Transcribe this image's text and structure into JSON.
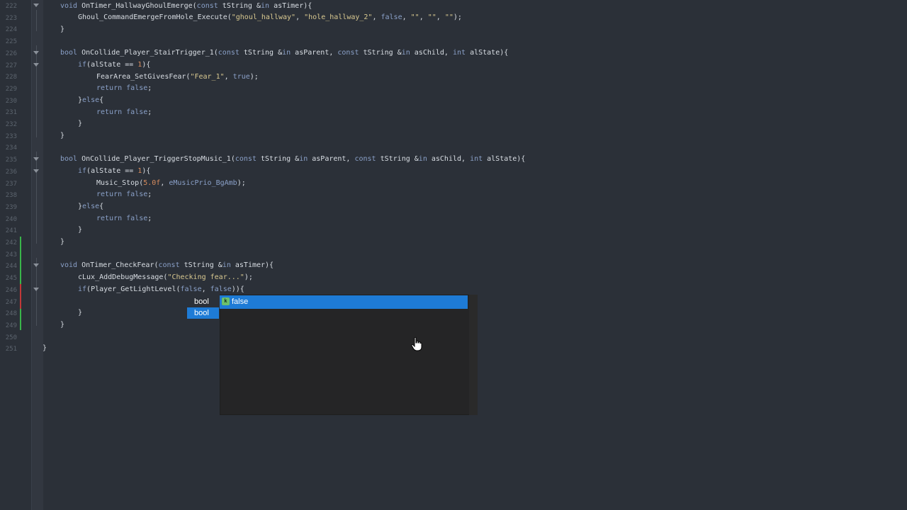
{
  "editor": {
    "line_numbers": [
      "222",
      "223",
      "224",
      "225",
      "226",
      "227",
      "228",
      "229",
      "230",
      "231",
      "232",
      "233",
      "234",
      "235",
      "236",
      "237",
      "238",
      "239",
      "240",
      "241",
      "242",
      "243",
      "244",
      "245",
      "246",
      "247",
      "248",
      "249",
      "250",
      "251"
    ],
    "lines": {
      "l222a": "void",
      "l222b": " OnTimer_HallwayGhoulEmerge(",
      "l222c": "const",
      "l222d": " tString &",
      "l222e": "in",
      "l222f": " asTimer){",
      "l223a": "Ghoul_CommandEmergeFromHole_Execute(",
      "l223b": "\"ghoul_hallway\"",
      "l223c": ", ",
      "l223d": "\"hole_hallway_2\"",
      "l223e": ", ",
      "l223f": "false",
      "l223g": ", ",
      "l223h": "\"\"",
      "l223i": ", ",
      "l223j": "\"\"",
      "l223k": ", ",
      "l223l": "\"\"",
      "l223m": ");",
      "l224": "}",
      "l226a": "bool",
      "l226b": " OnCollide_Player_StairTrigger_1(",
      "l226c": "const",
      "l226d": " tString &",
      "l226e": "in",
      "l226f": " asParent, ",
      "l226g": "const",
      "l226h": " tString &",
      "l226i": "in",
      "l226j": " asChild, ",
      "l226k": "int",
      "l226l": " alState){",
      "l227a": "if",
      "l227b": "(alState == ",
      "l227c": "1",
      "l227d": "){",
      "l228a": "FearArea_SetGivesFear(",
      "l228b": "\"Fear_1\"",
      "l228c": ", ",
      "l228d": "true",
      "l228e": ");",
      "l229a": "return",
      "l229b": " ",
      "l229c": "false",
      "l229d": ";",
      "l230a": "}",
      "l230b": "else",
      "l230c": "{",
      "l231a": "return",
      "l231b": " ",
      "l231c": "false",
      "l231d": ";",
      "l232": "}",
      "l233": "}",
      "l235a": "bool",
      "l235b": " OnCollide_Player_TriggerStopMusic_1(",
      "l235c": "const",
      "l235d": " tString &",
      "l235e": "in",
      "l235f": " asParent, ",
      "l235g": "const",
      "l235h": " tString &",
      "l235i": "in",
      "l235j": " asChild, ",
      "l235k": "int",
      "l235l": " alState){",
      "l236a": "if",
      "l236b": "(alState == ",
      "l236c": "1",
      "l236d": "){",
      "l237a": "Music_Stop(",
      "l237b": "5.0f",
      "l237c": ", ",
      "l237d": "eMusicPrio_BgAmb",
      "l237e": ");",
      "l238a": "return",
      "l238b": " ",
      "l238c": "false",
      "l238d": ";",
      "l239a": "}",
      "l239b": "else",
      "l239c": "{",
      "l240a": "return",
      "l240b": " ",
      "l240c": "false",
      "l240d": ";",
      "l241": "}",
      "l242": "}",
      "l244a": "void",
      "l244b": " OnTimer_CheckFear(",
      "l244c": "const",
      "l244d": " tString &",
      "l244e": "in",
      "l244f": " asTimer){",
      "l245a": "cLux_AddDebugMessage(",
      "l245b": "\"Checking fear...\"",
      "l245c": ");",
      "l246a": "if",
      "l246b": "(Player_GetLightLevel(",
      "l246c": "false",
      "l246d": ", ",
      "l246e": "false",
      "l246f": ")){",
      "l248": "}",
      "l249": "}",
      "l251": "}"
    }
  },
  "signature_hint": {
    "row1": "bool",
    "row2": "bool"
  },
  "autocomplete": {
    "selected_item": "false",
    "kind_icon": "k"
  },
  "colors": {
    "background": "#2b3038",
    "selection": "#1e7bd6",
    "keyword": "#8aa0c8",
    "string": "#d8c890",
    "number": "#d78c5e"
  }
}
